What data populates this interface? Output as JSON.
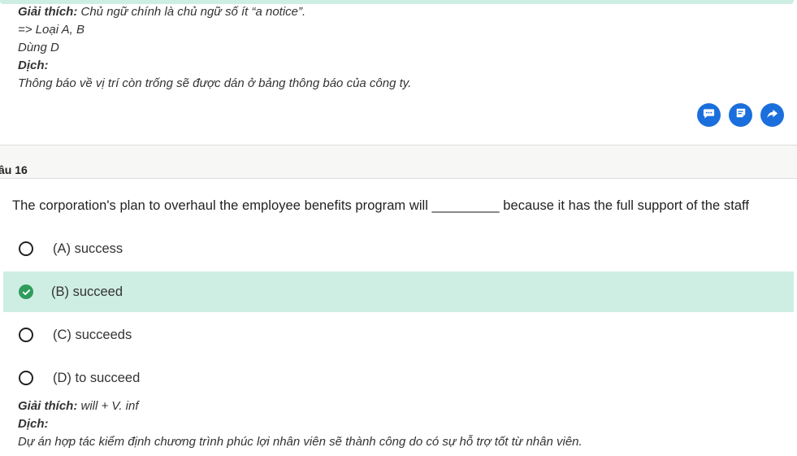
{
  "prev_explanation": {
    "line1_label": "Giải thích:",
    "line1_text": " Chủ ngữ chính là chủ ngữ số ít “a notice”.",
    "line2": "=> Loại A, B",
    "line3": "Dùng D",
    "translation_label": "Dịch:",
    "translation_text": "Thông báo về vị trí còn trống sẽ được dán ở bảng thông báo của công ty."
  },
  "actions": {
    "comment_icon": "comment-icon",
    "note_icon": "note-icon",
    "share_icon": "share-icon",
    "color": "#1a6fdc"
  },
  "question": {
    "label": "âu 16",
    "text": "The corporation's plan to overhaul the employee benefits program will _________ because it has the full support of the staff",
    "options": [
      {
        "text": "(A) success",
        "selected": false
      },
      {
        "text": "(B) succeed",
        "selected": true
      },
      {
        "text": "(C) succeeds",
        "selected": false
      },
      {
        "text": "(D) to succeed",
        "selected": false
      }
    ],
    "selected_color": "#cfeee3",
    "check_color": "#2e9d5b"
  },
  "explanation": {
    "label": "Giải thích:",
    "text": " will + V. inf",
    "translation_label": "Dịch:",
    "translation_text": "Dự án hợp tác kiểm định chương trình phúc lợi nhân viên sẽ thành công do có sự hỗ trợ tốt từ nhân viên."
  }
}
